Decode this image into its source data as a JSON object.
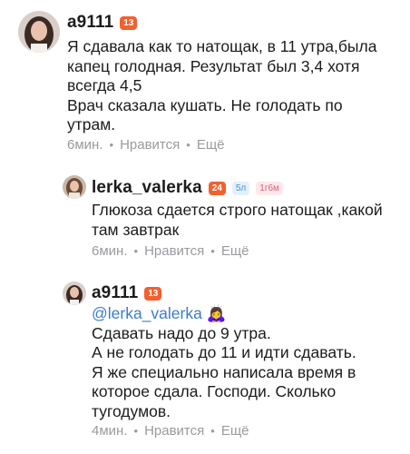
{
  "comments": [
    {
      "username": "a9111",
      "level_badge": "13",
      "text_lines": [
        "Я сдавала как то натощак, в 11 утра,была",
        "капец голодная. Результат был 3,4 хотя",
        "всегда 4,5",
        "Врач сказала кушать. Не голодать по",
        "утрам."
      ],
      "time": "6мин.",
      "like_label": "Нравится",
      "more_label": "Ещё"
    },
    {
      "username": "lerka_valerka",
      "level_badge": "24",
      "extra_badges": [
        "5л",
        "1г6м"
      ],
      "text_lines": [
        "Глюкоза сдается строго натощак ,какой",
        "там завтрак"
      ],
      "time": "6мин.",
      "like_label": "Нравится",
      "more_label": "Ещё"
    },
    {
      "username": "a9111",
      "level_badge": "13",
      "mention": "@lerka_valerka",
      "mention_emoji": "🙇‍♀️",
      "text_lines": [
        "Сдавать надо до 9 утра.",
        "А не голодать до 11 и идти сдавать.",
        "Я же специально написала время в",
        "которое сдала. Господи. Сколько",
        "тугодумов."
      ],
      "time": "4мин.",
      "like_label": "Нравится",
      "more_label": "Ещё"
    }
  ],
  "colors": {
    "badge_orange": "#f2602e",
    "mention_blue": "#3b7cc9",
    "meta_gray": "#9a9a9f"
  }
}
